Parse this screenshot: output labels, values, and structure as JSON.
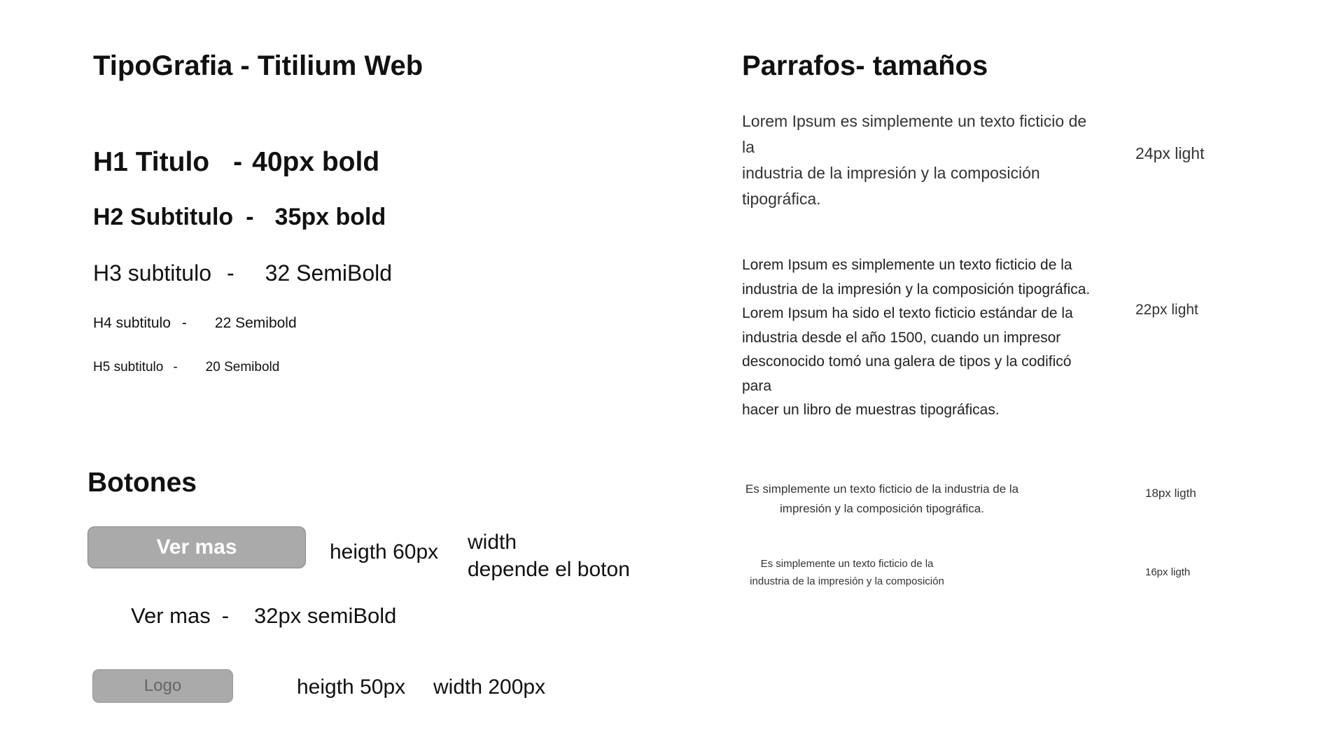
{
  "typography": {
    "title": "TipoGrafia - Titilium Web",
    "h1": {
      "name": "H1 Titulo",
      "sep": "-",
      "spec": "40px bold"
    },
    "h2": {
      "name": "H2 Subtitulo",
      "sep": "-",
      "spec": "35px bold"
    },
    "h3": {
      "name": "H3 subtitulo",
      "sep": "-",
      "spec": "32 SemiBold"
    },
    "h4": {
      "name": "H4 subtitulo",
      "sep": "-",
      "spec": "22 Semibold"
    },
    "h5": {
      "name": "H5 subtitulo",
      "sep": "-",
      "spec": "20  Semibold"
    }
  },
  "buttons": {
    "title": "Botones",
    "ver_mas_label": "Ver mas",
    "ver_mas_height_note": "heigth 60px",
    "ver_mas_width_note_line1": "width",
    "ver_mas_width_note_line2": "depende el boton",
    "ver_mas_spec_name": "Ver mas",
    "ver_mas_spec_sep": "-",
    "ver_mas_spec": "32px semiBold",
    "logo_label": "Logo",
    "logo_height_note": "heigth 50px",
    "logo_width_note": "width 200px",
    "button_color": "#aaaaaa"
  },
  "paragraphs": {
    "title": "Parrafos- tamaños",
    "p24": {
      "lines": [
        "Lorem Ipsum es simplemente un texto ficticio de",
        "la",
        "industria de la impresión y la composición",
        "tipográfica."
      ],
      "label": "24px light"
    },
    "p22": {
      "lines": [
        "Lorem Ipsum es simplemente un texto ficticio de la",
        "industria de la impresión y la composición tipográfica.",
        "Lorem Ipsum ha sido el texto ficticio estándar de la",
        "industria desde el año 1500, cuando un impresor",
        "desconocido tomó una galera de tipos y la codificó",
        "para",
        "hacer un libro de muestras tipográficas."
      ],
      "label": "22px light"
    },
    "p18": {
      "lines": [
        "Es simplemente un texto ficticio de la industria de la",
        "impresión y la composición tipográfica."
      ],
      "label": "18px ligth"
    },
    "p16": {
      "lines": [
        "Es simplemente un texto ficticio de la",
        "industria de la impresión y la composición"
      ],
      "label": "16px ligth"
    }
  }
}
